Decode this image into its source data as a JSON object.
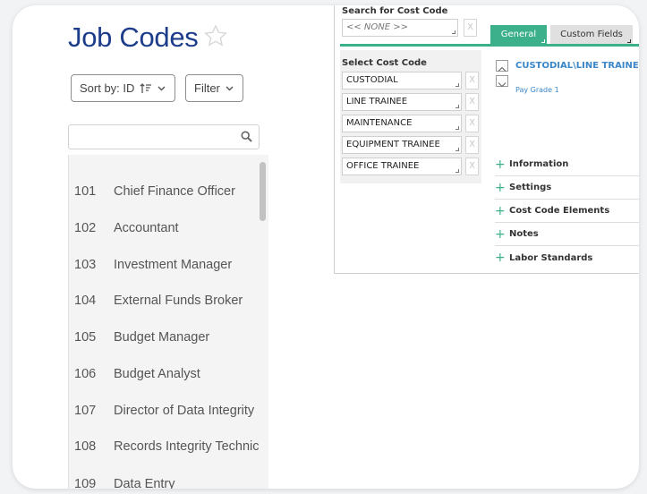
{
  "page": {
    "title": "Job Codes",
    "sort_label": "Sort by: ID",
    "filter_label": "Filter",
    "search_placeholder": ""
  },
  "job_codes": [
    {
      "id": "101",
      "name": "Chief Finance Officer"
    },
    {
      "id": "102",
      "name": "Accountant"
    },
    {
      "id": "103",
      "name": "Investment Manager"
    },
    {
      "id": "104",
      "name": "External Funds Broker"
    },
    {
      "id": "105",
      "name": "Budget Manager"
    },
    {
      "id": "106",
      "name": "Budget Analyst"
    },
    {
      "id": "107",
      "name": "Director of Data Integrity"
    },
    {
      "id": "108",
      "name": "Records Integrity Technic"
    },
    {
      "id": "109",
      "name": "Data Entry"
    }
  ],
  "cost_code_panel": {
    "search_label": "Search for Cost Code",
    "search_value": "<< NONE >>",
    "clear_label": "X",
    "tabs": [
      {
        "label": "General",
        "active": true
      },
      {
        "label": "Custom Fields",
        "active": false
      }
    ],
    "select_label": "Select Cost Code",
    "cost_codes": [
      "CUSTODIAL",
      "LINE TRAINEE",
      "MAINTENANCE",
      "EQUIPMENT TRAINEE",
      "OFFICE TRAINEE"
    ],
    "selected_title": "CUSTODIAL\\LINE TRAINEE\\",
    "pay_grade": "Pay Grade 1",
    "sections": [
      "Information",
      "Settings",
      "Cost Code Elements",
      "Notes",
      "Labor Standards"
    ]
  },
  "colors": {
    "title_blue": "#1d3d8a",
    "accent_green": "#3bb08a",
    "link_blue": "#3a86c8"
  }
}
